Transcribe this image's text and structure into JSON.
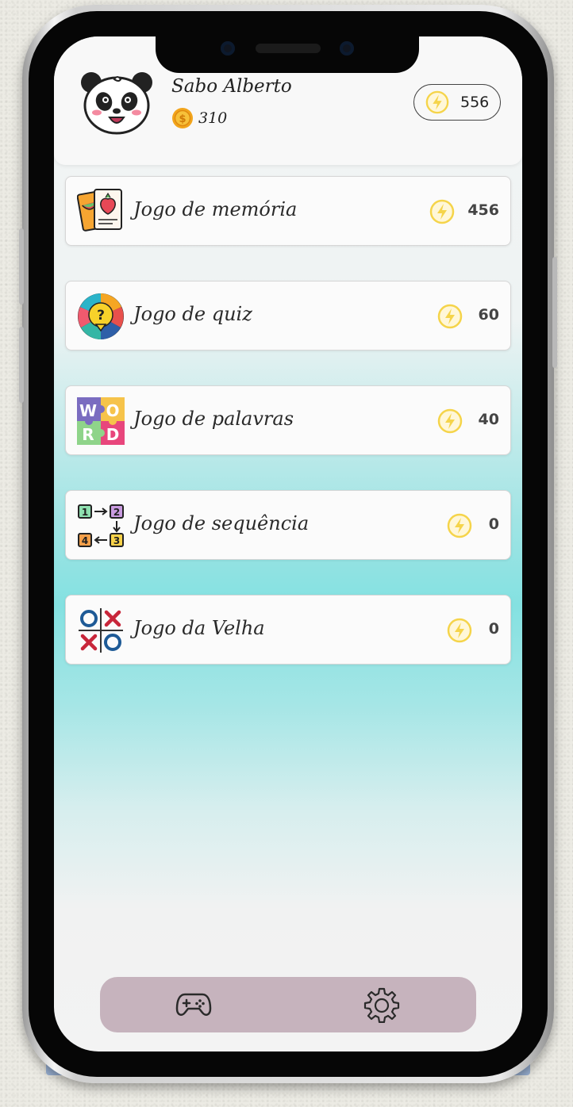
{
  "user": {
    "name": "Sabo Alberto",
    "coins": "310",
    "energy": "556"
  },
  "games": [
    {
      "title": "Jogo de memória",
      "energy": "456",
      "icon": "memory-cards-icon"
    },
    {
      "title": "Jogo de quiz",
      "energy": "60",
      "icon": "quiz-wheel-icon"
    },
    {
      "title": "Jogo de palavras",
      "energy": "40",
      "icon": "word-tiles-icon"
    },
    {
      "title": "Jogo de sequência",
      "energy": "0",
      "icon": "sequence-icon"
    },
    {
      "title": "Jogo da Velha",
      "energy": "0",
      "icon": "tic-tac-toe-icon"
    }
  ],
  "nav": {
    "items": [
      {
        "icon": "gamepad-icon"
      },
      {
        "icon": "gear-icon"
      }
    ]
  },
  "colors": {
    "nav_background": "#c6b3bd",
    "bolt": "#f5d44a",
    "coin": "#f2a51c",
    "screen_accent": "#84e1e1"
  }
}
